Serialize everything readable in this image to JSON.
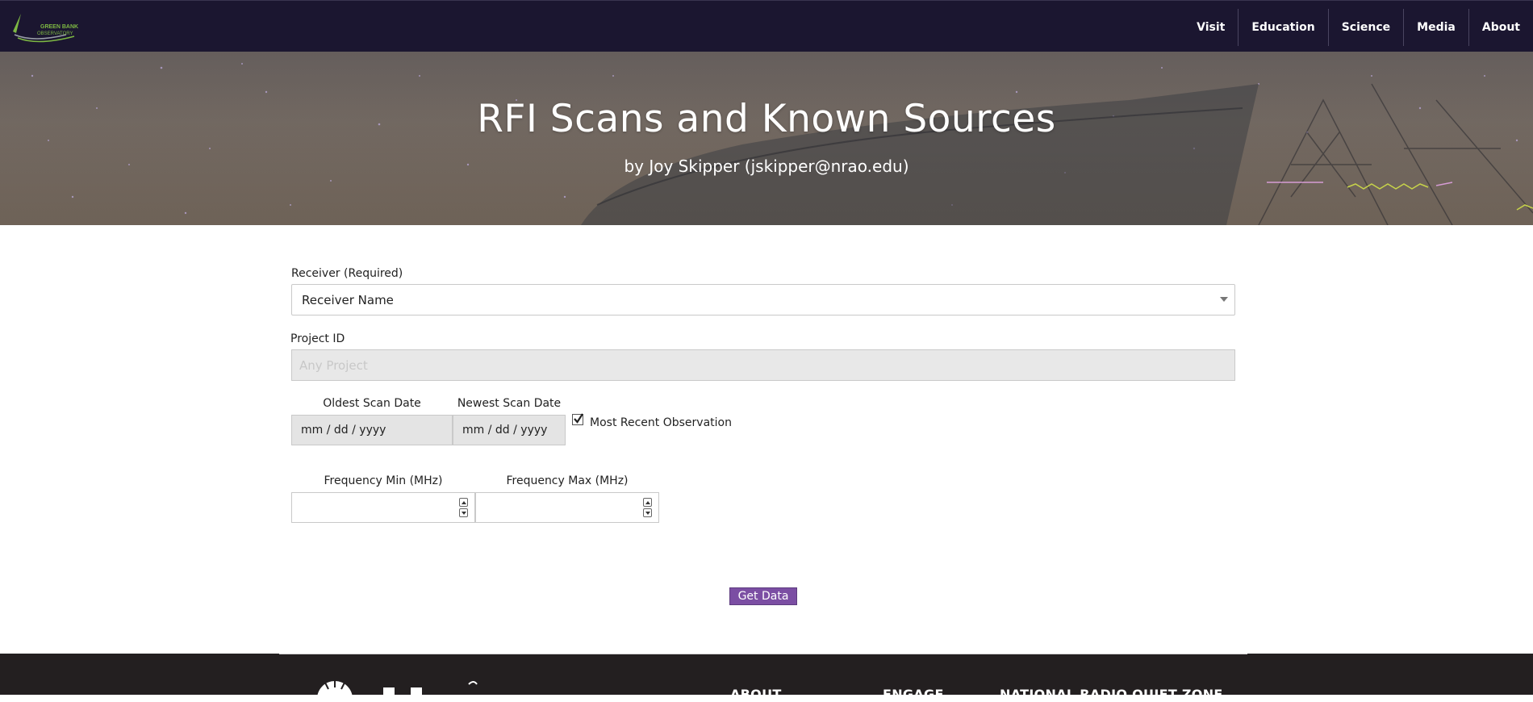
{
  "brand": {
    "logo_text_1": "GREEN BANK",
    "logo_text_2": "OBSERVATORY"
  },
  "nav": [
    "Visit",
    "Education",
    "Science",
    "Media",
    "About"
  ],
  "hero": {
    "title": "RFI Scans and Known Sources",
    "subtitle": "by Joy Skipper (jskipper@nrao.edu)"
  },
  "form": {
    "receiver_label": "Receiver (Required)",
    "receiver_value": "Receiver Name",
    "project_label": "Project ID",
    "project_placeholder": "Any Project",
    "oldest_label": "Oldest Scan Date",
    "oldest_value": "mm / dd / yyyy",
    "newest_label": "Newest Scan Date",
    "newest_value": "mm / dd / yyyy",
    "most_recent_label": "Most Recent Observation",
    "most_recent_checked": true,
    "freq_min_label": "Frequency Min (MHz)",
    "freq_max_label": "Frequency Max (MHz)",
    "submit_label": "Get Data"
  },
  "footer": {
    "headings": [
      "ABOUT",
      "ENGAGE",
      "NATIONAL RADIO QUIET ZONE"
    ]
  },
  "colors": {
    "nav_bg": "#1b1630",
    "accent": "#7b4ea3",
    "footer_bg": "#231f20"
  }
}
